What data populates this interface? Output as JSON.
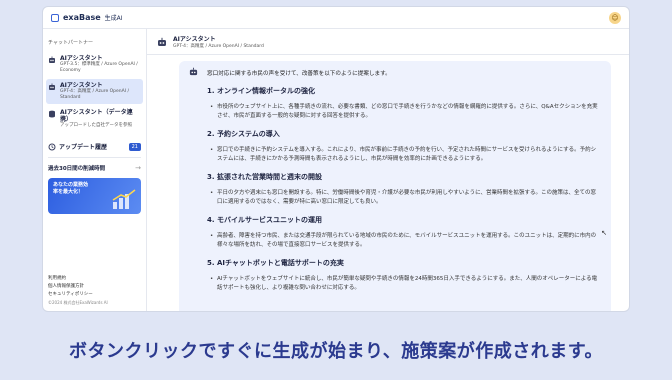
{
  "app": {
    "brand": "exaBase",
    "sub": "生成AI"
  },
  "sidebar": {
    "heading": "チャットパートナー",
    "partners": [
      {
        "name": "AIアシスタント",
        "desc": "GPT-3.5：標準精度 / Azure OpenAI / Economy"
      },
      {
        "name": "AIアシスタント",
        "desc": "GPT-4：高精度 / Azure OpenAI / Standard"
      },
      {
        "name": "AIアシスタント（データ連携）",
        "desc": "アップロードした自社データを参照"
      }
    ],
    "updates_label": "アップデート履歴",
    "updates_count": "21",
    "reduced_label": "過去30日間の削減時間",
    "promo_text": "あなたの業務効率を最大化！",
    "links": [
      "利用規約",
      "個人情報保護方針",
      "セキュリティポリシー"
    ],
    "copyright": "©2024 株式会社ExaWizards AI"
  },
  "chat": {
    "partner_name": "AIアシスタント",
    "partner_desc": "GPT-4：高精度 / Azure OpenAI / Standard",
    "intro": "窓口対応に関する市民の声を受けて、改善策を以下のように提案します。",
    "sections": [
      {
        "title": "1. オンライン情報ポータルの強化",
        "body": "市役所のウェブサイト上に、各種手続きの流れ、必要な書類、どの窓口で手続きを行うかなどの情報を網羅的に提供する。さらに、Q&Aセクションを充実させ、市民が直面する一般的な疑問に対する回答を提供する。"
      },
      {
        "title": "2. 予約システムの導入",
        "body": "窓口での手続きに予約システムを導入する。これにより、市民が事前に手続きの予約を行い、予定された時間にサービスを受けられるようにする。予約システムには、手続きにかかる予測時間も表示されるようにし、市民が時間を効率的に計画できるようにする。"
      },
      {
        "title": "3. 拡張された営業時間と週末の開設",
        "body": "平日の夕方や週末にも窓口を開設する。特に、労働時間後や育児・介護が必要な市民が利用しやすいように、営業時間を拡張する。この施策は、全ての窓口に適用するのではなく、需要が特に高い窓口に限定しても良い。"
      },
      {
        "title": "4. モバイルサービスユニットの運用",
        "body": "高齢者、障害を持つ市民、または交通手段が限られている地域の市民のために、モバイルサービスユニットを運用する。このユニットは、定期的に市内の様々な場所を訪れ、その場で直接窓口サービスを提供する。"
      },
      {
        "title": "5. AIチャットボットと電話サポートの充実",
        "body": "AIチャットボットをウェブサイトに統合し、市民が簡単な疑問や手続きの情報を24時間365日入手できるようにする。また、人間のオペレーターによる電話サポートも強化し、より複雑な問い合わせに対応する。"
      }
    ]
  },
  "caption": "ボタンクリックですぐに生成が始まり、施策案が作成されます。"
}
